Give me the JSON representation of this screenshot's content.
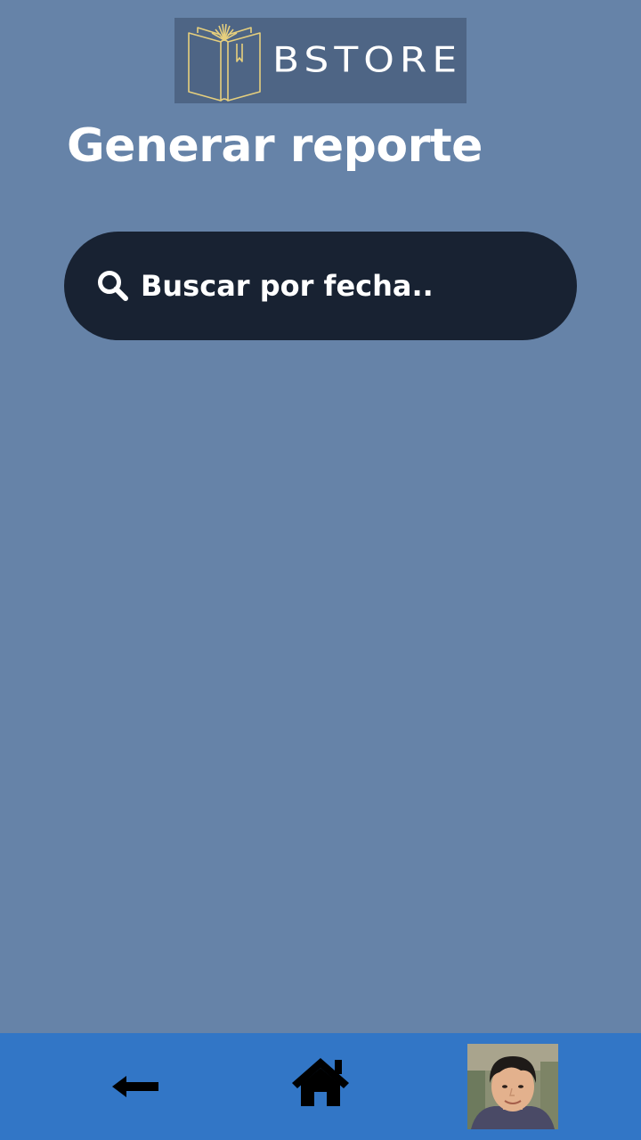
{
  "brand": {
    "logo_text": "BSTORE"
  },
  "header": {
    "title": "Generar reporte"
  },
  "search": {
    "placeholder": "Buscar por fecha..",
    "icon": "search-icon"
  },
  "bottom_nav": {
    "items": [
      {
        "icon": "arrow-left-icon"
      },
      {
        "icon": "home-icon"
      },
      {
        "icon": "avatar"
      }
    ]
  },
  "colors": {
    "background": "#6683a8",
    "logo_background": "#4e6585",
    "logo_accent": "#e6cf7d",
    "search_background": "#182232",
    "nav_background": "#3276c6",
    "text": "#ffffff"
  }
}
